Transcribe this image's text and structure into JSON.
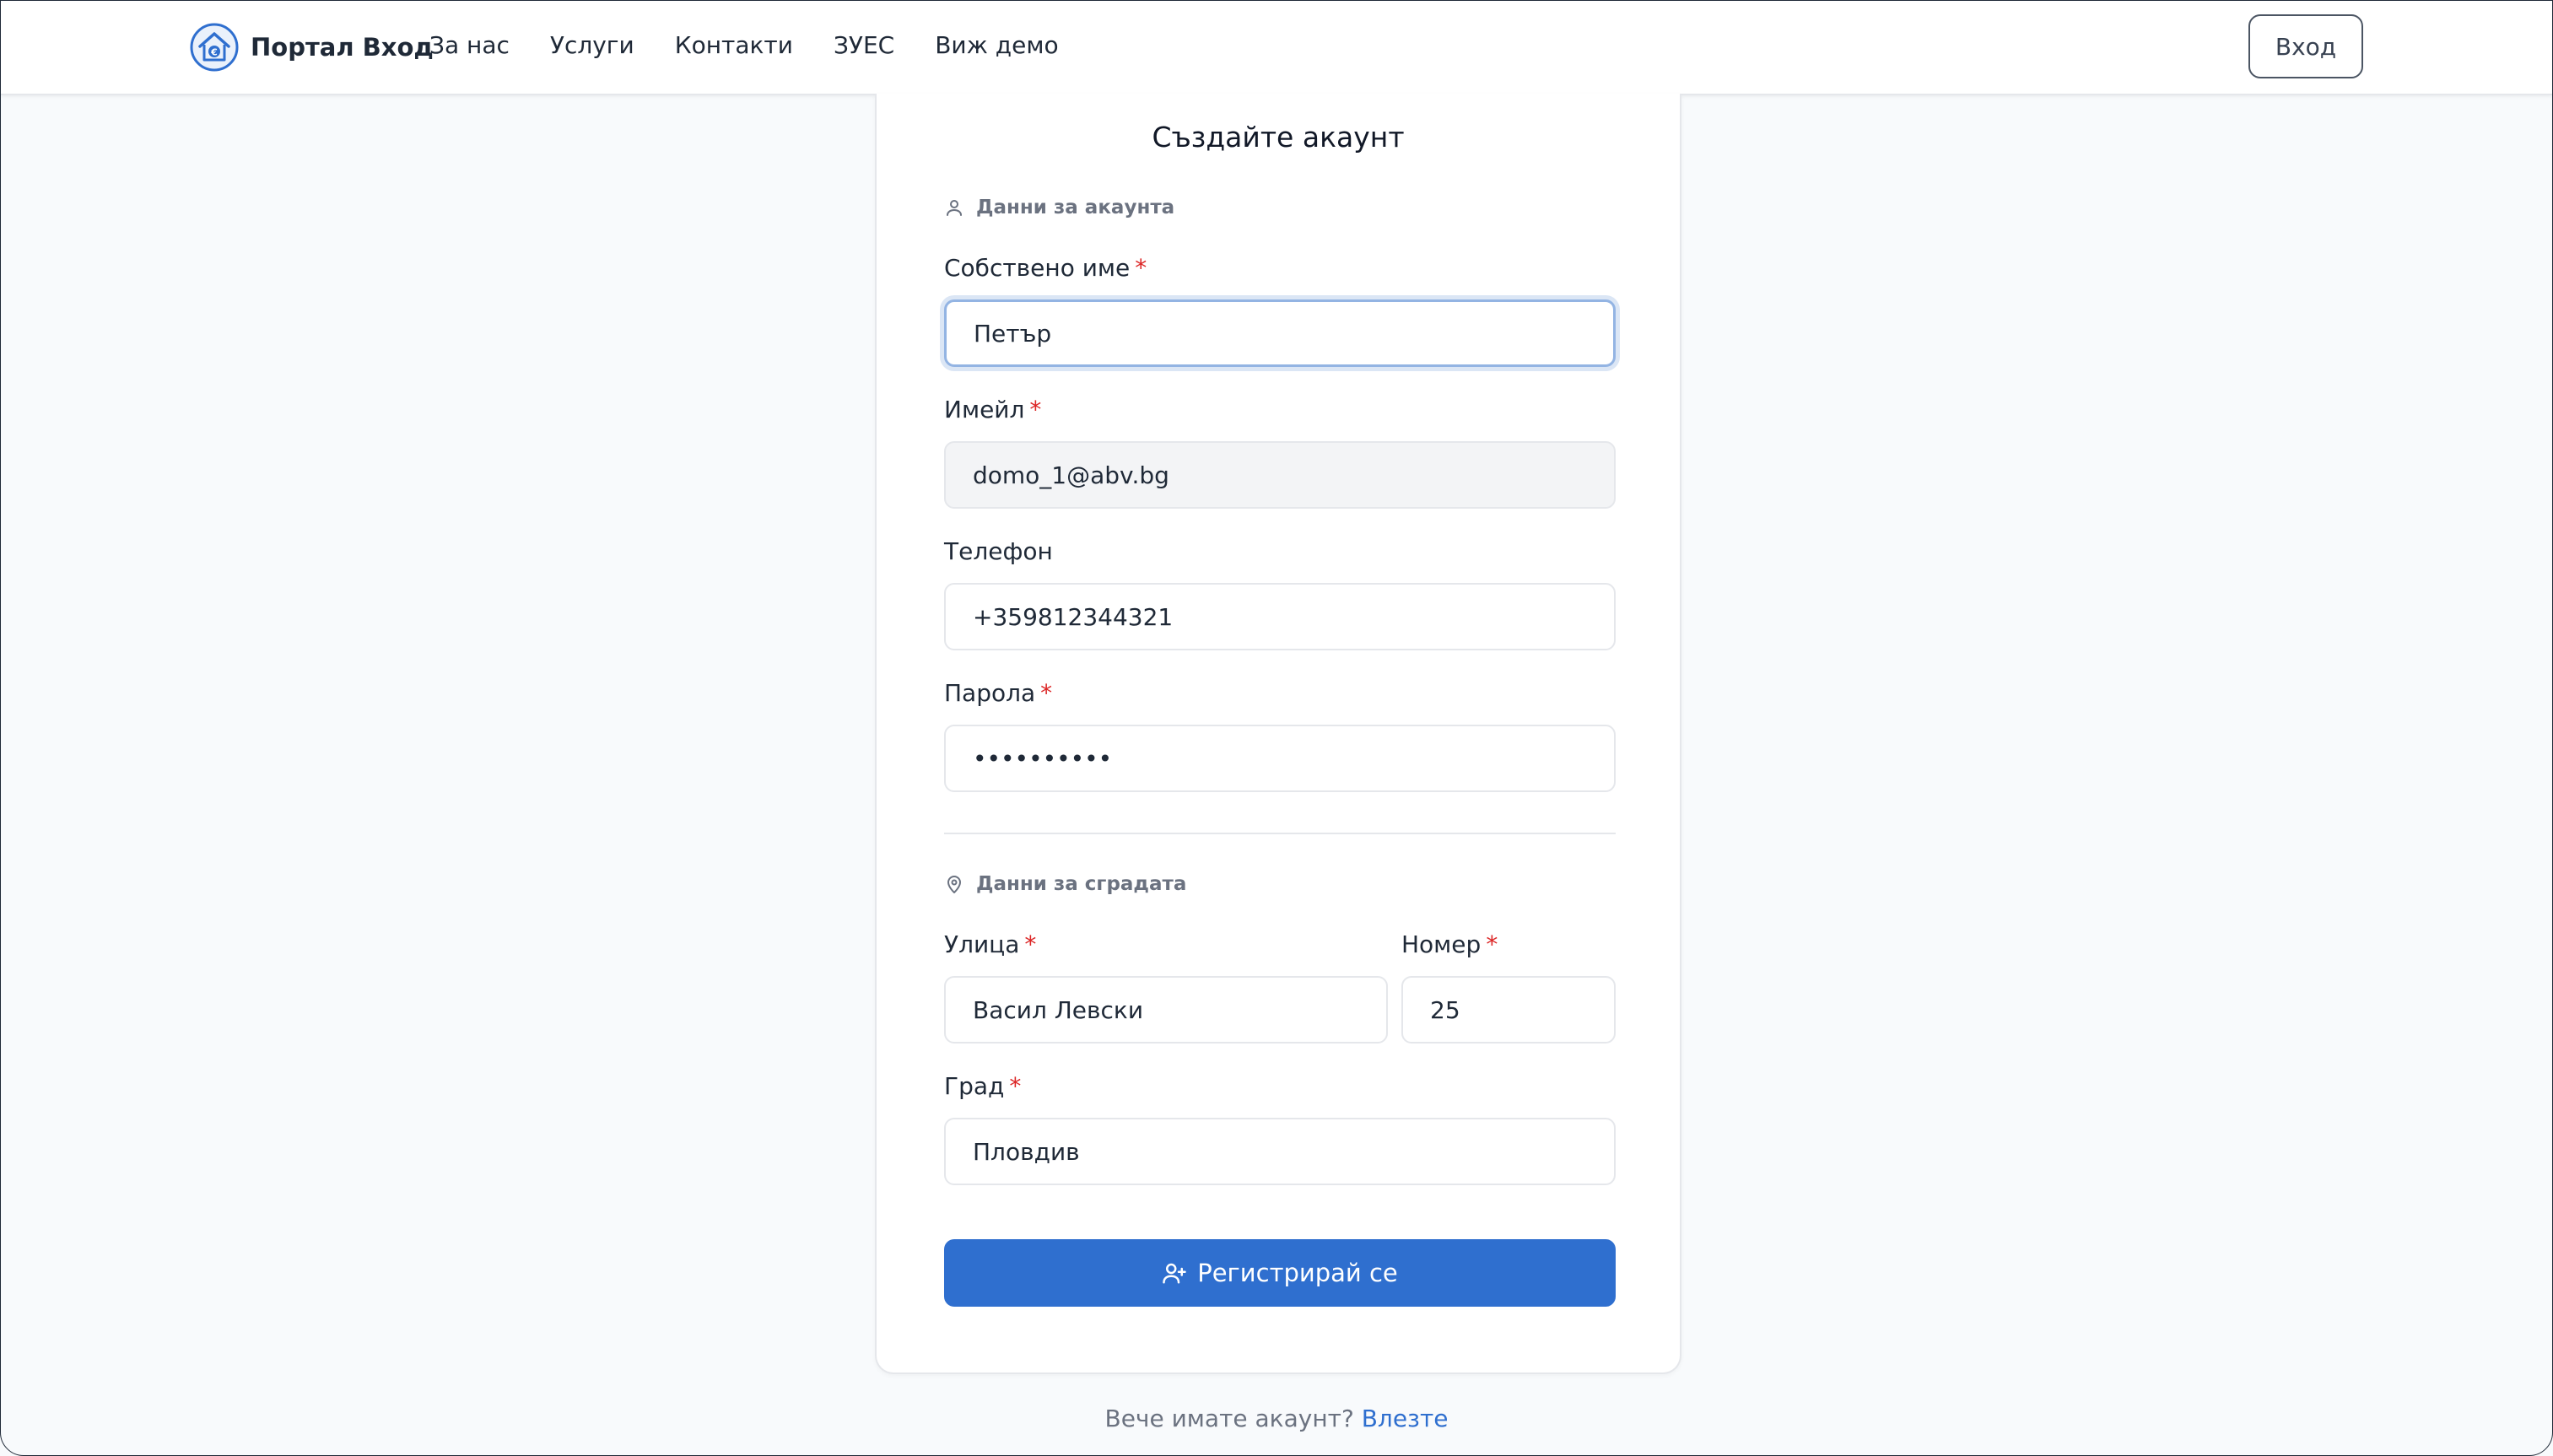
{
  "header": {
    "brand_name": "Портал Вход",
    "nav": [
      "За нас",
      "Услуги",
      "Контакти",
      "ЗУЕС",
      "Виж демо"
    ],
    "login_label": "Вход"
  },
  "form": {
    "title": "Създайте акаунт",
    "account_section": "Данни за акаунта",
    "first_name": {
      "label": "Собствено име",
      "value": "Петър"
    },
    "email": {
      "label": "Имейл",
      "value": "domo_1@abv.bg"
    },
    "phone": {
      "label": "Телефон",
      "value": "+359812344321"
    },
    "password": {
      "label": "Парола",
      "value": "••••••••••"
    },
    "building_section": "Данни за сградата",
    "street": {
      "label": "Улица",
      "value": "Васил Левски"
    },
    "number": {
      "label": "Номер",
      "value": "25"
    },
    "city": {
      "label": "Град",
      "value": "Пловдив"
    },
    "required_mark": "*",
    "submit_label": "Регистрирай се"
  },
  "footer": {
    "question": "Вече имате акаунт?",
    "link": "Влезте"
  },
  "colors": {
    "primary": "#2f6fcf",
    "required": "#dc2626"
  },
  "icons": {
    "logo": "house-euro-logo",
    "account_section": "user-icon",
    "building_section": "map-pin-icon",
    "submit": "user-plus-icon"
  }
}
